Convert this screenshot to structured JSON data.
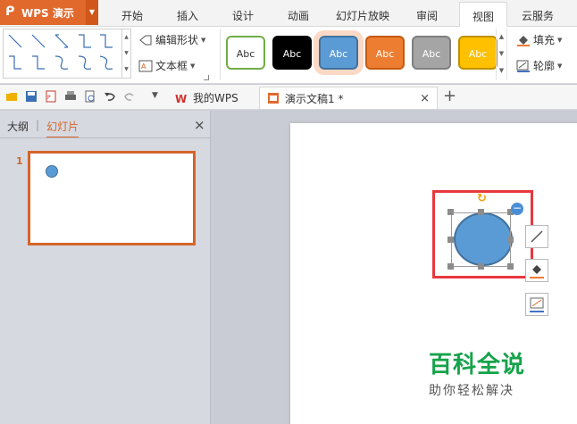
{
  "app": {
    "name": "WPS 演示",
    "logo_glyph": "ᑭ",
    "accent": "#e2692c"
  },
  "menu": {
    "items": [
      "开始",
      "插入",
      "设计",
      "动画",
      "幻灯片放映",
      "审阅",
      "视图",
      "云服务"
    ],
    "active": "视图"
  },
  "ribbon": {
    "edit_shape": "编辑形状",
    "text_box": "文本框",
    "fill": "填充",
    "outline": "轮廓",
    "style_samples": [
      {
        "label": "Abc",
        "bg": "#ffffff",
        "fg": "#333333",
        "border": "#70ad47"
      },
      {
        "label": "Abc",
        "bg": "#000000",
        "fg": "#ffffff",
        "border": "#000000"
      },
      {
        "label": "Abc",
        "bg": "#5b9bd5",
        "fg": "#ffffff",
        "border": "#41719c"
      },
      {
        "label": "Abc",
        "bg": "#ed7d31",
        "fg": "#ffffff",
        "border": "#c55a11"
      },
      {
        "label": "Abc",
        "bg": "#a5a5a5",
        "fg": "#ffffff",
        "border": "#7f7f7f"
      },
      {
        "label": "Abc",
        "bg": "#ffc000",
        "fg": "#ffffff",
        "border": "#bf9000"
      }
    ]
  },
  "tabs": {
    "mywps": "我的WPS",
    "doc": "演示文稿1 *",
    "close_glyph": "×",
    "add_glyph": "+"
  },
  "left_panel": {
    "tab_outline": "大纲",
    "tab_slides": "幻灯片",
    "separator": "|",
    "close_glyph": "×",
    "slide_number": "1"
  },
  "canvas": {
    "shape_color": "#5b9bd5",
    "highlight_color": "#e8383d",
    "rotate_glyph": "↻",
    "minus_glyph": "−"
  },
  "watermark": {
    "main": "百科全说",
    "sub": "助你轻松解决"
  }
}
